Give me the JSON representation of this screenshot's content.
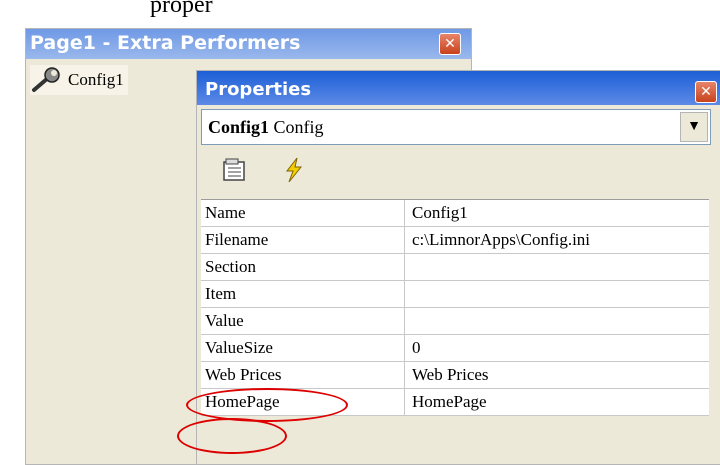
{
  "top_partial_text": "proper",
  "performers_window": {
    "title": "Page1 - Extra Performers",
    "close_glyph": "✕",
    "items": [
      {
        "icon": "wrench-icon",
        "label": "Config1"
      }
    ]
  },
  "properties_window": {
    "title": "Properties",
    "close_glyph": "✕",
    "object_selector": {
      "name": "Config1",
      "type": "Config"
    },
    "toolbar": {
      "buttons": [
        "properties-icon",
        "events-lightning-icon"
      ]
    },
    "properties": [
      {
        "name": "Name",
        "value": "Config1"
      },
      {
        "name": "Filename",
        "value": "c:\\LimnorApps\\Config.ini"
      },
      {
        "name": "Section",
        "value": ""
      },
      {
        "name": "Item",
        "value": ""
      },
      {
        "name": "Value",
        "value": ""
      },
      {
        "name": "ValueSize",
        "value": "0"
      },
      {
        "name": "Web Prices",
        "value": "Web Prices"
      },
      {
        "name": "HomePage",
        "value": "HomePage"
      }
    ]
  },
  "colors": {
    "highlight_circle": "#dd0000",
    "active_title_bar": "#1c5fd6",
    "inactive_title_bar": "#7ea3e8"
  }
}
